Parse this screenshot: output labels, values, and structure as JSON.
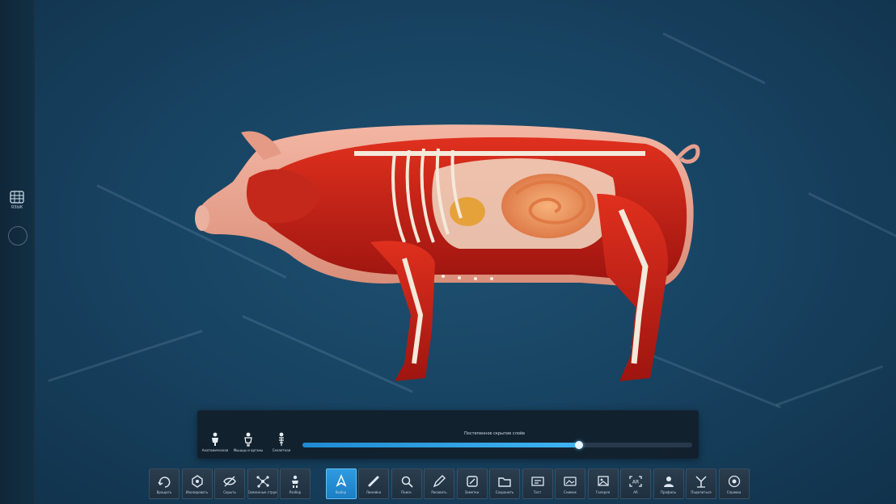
{
  "left_rail": {
    "layers_button": {
      "icon": "layers-grid-icon",
      "label": "ЯЗЫК"
    },
    "secondary_button": {
      "icon": "gear-circle-icon"
    }
  },
  "viewer": {
    "model_icon": "pig-anatomy-model"
  },
  "animation_panel": {
    "modes": [
      {
        "icon": "figure-skin-icon",
        "label": "Анатомическая",
        "active": false
      },
      {
        "icon": "figure-muscle-icon",
        "label": "Мышцы и органы",
        "active": true
      },
      {
        "icon": "figure-skeleton-icon",
        "label": "Скелетная",
        "active": false
      }
    ],
    "slider": {
      "label": "Постепенное скрытие слоёв",
      "value": 0.71
    }
  },
  "toolbar": {
    "active_index": 5,
    "accent_color": "#1d8ad2",
    "tools": [
      {
        "icon": "rotate-icon",
        "label": "Вращать"
      },
      {
        "icon": "isolate-icon",
        "label": "Изолировать"
      },
      {
        "icon": "hide-eye-icon",
        "label": "Скрыть"
      },
      {
        "icon": "nodes-icon",
        "label": "Связанные структуры"
      },
      {
        "icon": "explode-icon",
        "label": "Разбор"
      },
      {
        "icon": "select-cursor-icon",
        "label": "Выбор"
      },
      {
        "icon": "ruler-icon",
        "label": "Линейка"
      },
      {
        "icon": "search-zoom-icon",
        "label": "Поиск"
      },
      {
        "icon": "pen-icon",
        "label": "Рисовать"
      },
      {
        "icon": "notes-icon",
        "label": "Заметки"
      },
      {
        "icon": "folder-icon",
        "label": "Сохранить"
      },
      {
        "icon": "quiz-icon",
        "label": "Тест"
      },
      {
        "icon": "screenshot-icon",
        "label": "Снимок"
      },
      {
        "icon": "gallery-icon",
        "label": "Галерея"
      },
      {
        "icon": "ar-icon",
        "label": "AR"
      },
      {
        "icon": "user-icon",
        "label": "Профиль"
      },
      {
        "icon": "share-icon",
        "label": "Поделиться"
      },
      {
        "icon": "help-icon",
        "label": "Справка"
      }
    ]
  }
}
